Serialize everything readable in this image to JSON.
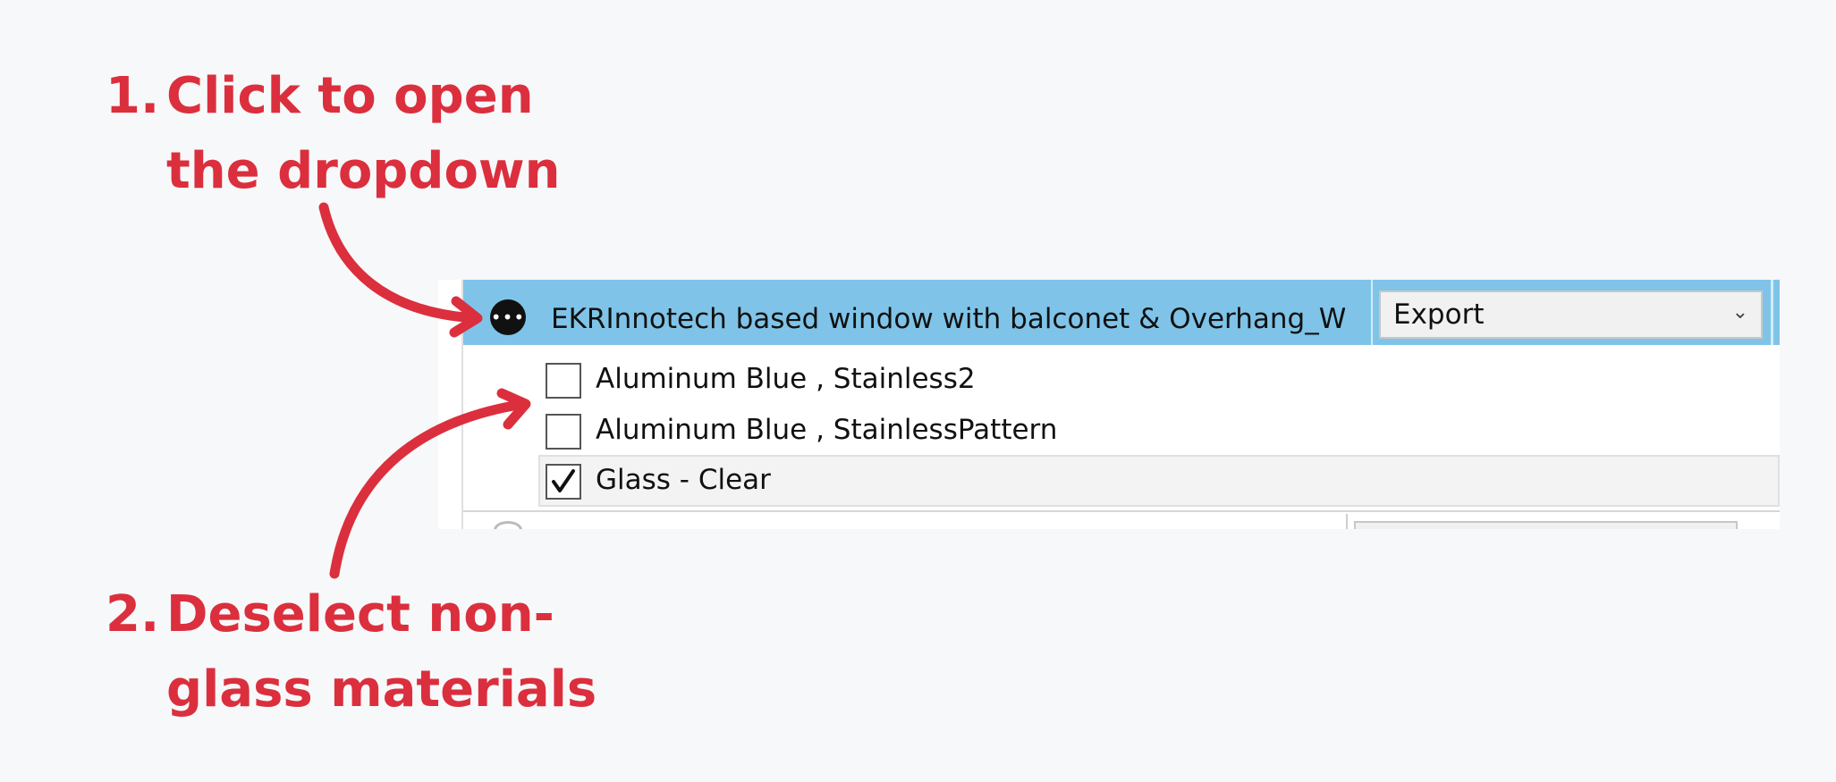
{
  "annotations": {
    "step1": {
      "number": "1.",
      "text": "Click to open the dropdown"
    },
    "step2": {
      "number": "2.",
      "text": "Deselect non-glass materials"
    },
    "color": "#db2f3d"
  },
  "material_row": {
    "icon": "more-icon",
    "name": "EKRInnotech based window with balconet & Overhang_Window",
    "export_value": "Export",
    "dropdown_icon": "chevron-down-icon",
    "highlight_color": "#7fc4e8"
  },
  "items": [
    {
      "label": "Aluminum Blue , Stainless2",
      "checked": false
    },
    {
      "label": "Aluminum Blue , StainlessPattern",
      "checked": false
    },
    {
      "label": "Glass - Clear",
      "checked": true
    }
  ]
}
